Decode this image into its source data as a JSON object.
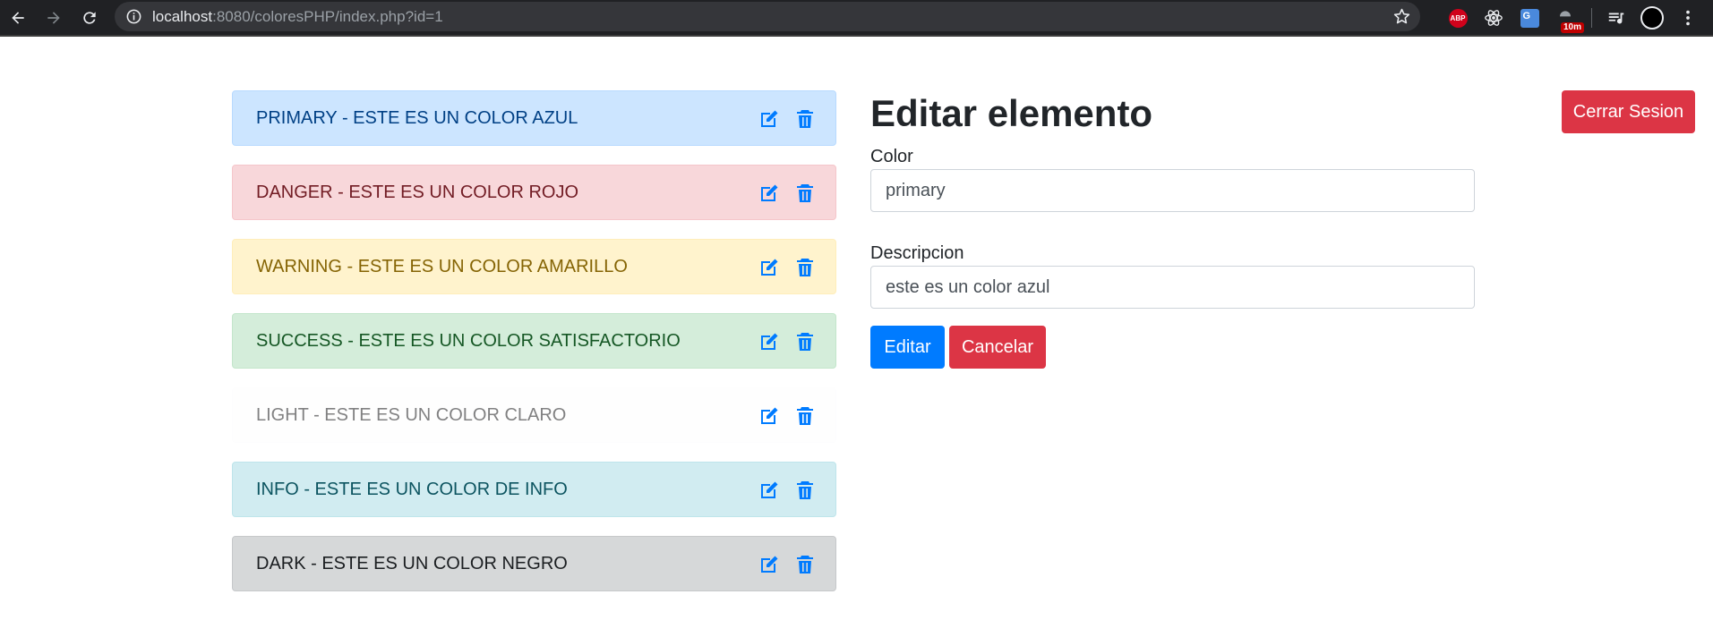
{
  "browser": {
    "url_host": "localhost",
    "url_rest": ":8080/coloresPHP/index.php?id=1",
    "extensions": {
      "abp_label": "ABP",
      "translate_label": "G",
      "timer_badge": "10m"
    }
  },
  "list": {
    "items": [
      {
        "label": "PRIMARY - ESTE ES UN COLOR AZUL",
        "bg": "#cce5ff",
        "border": "#b8daff",
        "color": "#004085"
      },
      {
        "label": "DANGER - ESTE ES UN COLOR ROJO",
        "bg": "#f8d7da",
        "border": "#f5c6cb",
        "color": "#721c24"
      },
      {
        "label": "WARNING - ESTE ES UN COLOR AMARILLO",
        "bg": "#fff3cd",
        "border": "#ffeeba",
        "color": "#856404"
      },
      {
        "label": "SUCCESS - ESTE ES UN COLOR SATISFACTORIO",
        "bg": "#d4edda",
        "border": "#c3e6cb",
        "color": "#155724"
      },
      {
        "label": "LIGHT - ESTE ES UN COLOR CLARO",
        "bg": "#fefefe",
        "border": "#fdfdfe",
        "color": "#818182"
      },
      {
        "label": "INFO - ESTE ES UN COLOR DE INFO",
        "bg": "#d1ecf1",
        "border": "#bee5eb",
        "color": "#0c5460"
      },
      {
        "label": "DARK - ESTE ES UN COLOR NEGRO",
        "bg": "#d6d8d9",
        "border": "#c6c8ca",
        "color": "#1b1e21"
      }
    ],
    "icon_color": "#007bff"
  },
  "form": {
    "title": "Editar elemento",
    "color_label": "Color",
    "color_value": "primary",
    "descripcion_label": "Descripcion",
    "descripcion_value": "este es un color azul",
    "submit_label": "Editar",
    "cancel_label": "Cancelar"
  },
  "header": {
    "logout_label": "Cerrar Sesion"
  },
  "colors": {
    "primary": "#007bff",
    "danger": "#dc3545"
  }
}
